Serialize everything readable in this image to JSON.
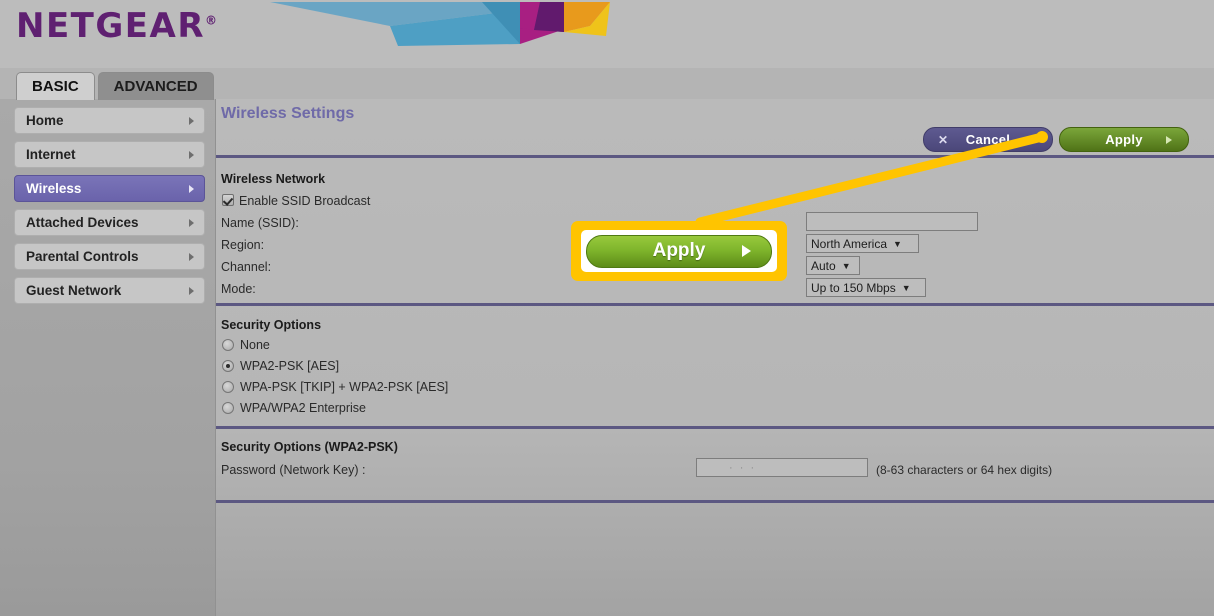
{
  "brand": {
    "name": "NETGEAR",
    "registered_mark": "®",
    "color": "#5f2071"
  },
  "tabs": [
    {
      "label": "BASIC",
      "active": true
    },
    {
      "label": "ADVANCED",
      "active": false
    }
  ],
  "sidebar": {
    "items": [
      {
        "label": "Home",
        "selected": false
      },
      {
        "label": "Internet",
        "selected": false
      },
      {
        "label": "Wireless",
        "selected": true
      },
      {
        "label": "Attached Devices",
        "selected": false
      },
      {
        "label": "Parental Controls",
        "selected": false
      },
      {
        "label": "Guest Network",
        "selected": false
      }
    ]
  },
  "page": {
    "title": "Wireless Settings"
  },
  "actions": {
    "cancel_label": "Cancel",
    "cancel_icon": "x-icon",
    "apply_label": "Apply",
    "apply_icon": "triangle-right-icon"
  },
  "wireless_network": {
    "section_title": "Wireless Network",
    "enable_ssid_broadcast_label": "Enable SSID Broadcast",
    "enable_ssid_broadcast_checked": true,
    "name_label": "Name (SSID):",
    "name_value": "",
    "region_label": "Region:",
    "region_value": "North America",
    "channel_label": "Channel:",
    "channel_value": "Auto",
    "mode_label": "Mode:",
    "mode_value": "Up to 150 Mbps"
  },
  "security_options": {
    "section_title": "Security Options",
    "options": [
      {
        "label": "None",
        "selected": false
      },
      {
        "label": "WPA2-PSK [AES]",
        "selected": true
      },
      {
        "label": "WPA-PSK [TKIP] + WPA2-PSK [AES]",
        "selected": false
      },
      {
        "label": "WPA/WPA2 Enterprise",
        "selected": false
      }
    ]
  },
  "security_wpa2psk": {
    "section_title": "Security Options (WPA2-PSK)",
    "password_label": "Password (Network Key) :",
    "password_value": "· · ·",
    "password_hint": "(8-63 characters or 64 hex digits)"
  },
  "callout": {
    "button_label": "Apply",
    "button_icon": "triangle-right-icon",
    "highlight_color": "#ffc400",
    "button_color": "#7fb52c"
  }
}
